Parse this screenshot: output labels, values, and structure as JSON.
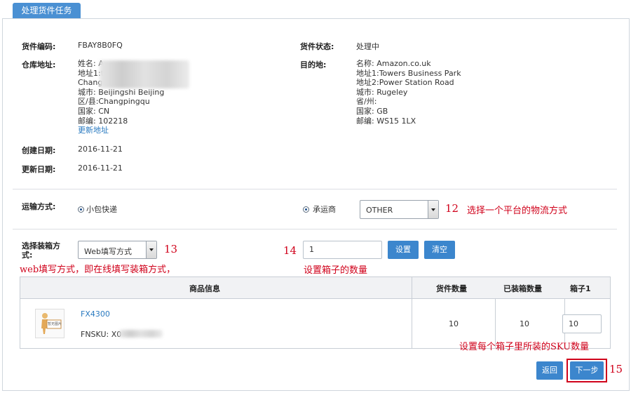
{
  "tab": {
    "title": "处理货件任务"
  },
  "shipment": {
    "code_label": "货件编码:",
    "code_value": "FBAY8B0FQ",
    "status_label": "货件状态:",
    "status_value": "处理中",
    "warehouse_label": "仓库地址:",
    "warehouse_lines": [
      "姓名: A",
      "地址1:t",
      "Chang",
      "城市: Beijingshi Beijing",
      "区/县:Changpingqu",
      "国家: CN",
      "邮编: 102218"
    ],
    "update_address_link": "更新地址",
    "destination_label": "目的地:",
    "destination_lines": [
      "名称: Amazon.co.uk",
      "地址1:Towers Business Park",
      "地址2:Power Station Road",
      "城市: Rugeley",
      "省/州:",
      "国家: GB",
      "邮编: WS15 1LX"
    ],
    "created_label": "创建日期:",
    "created_value": "2016-11-21",
    "updated_label": "更新日期:",
    "updated_value": "2016-11-21"
  },
  "shipping": {
    "label": "运输方式:",
    "option_small_parcel": "小包快递",
    "option_carrier": "承运商",
    "carrier_select_value": "OTHER"
  },
  "packing": {
    "label_line1": "选择装箱方",
    "label_line2": "式:",
    "select_value": "Web填写方式",
    "box_count_value": "1",
    "set_button": "设置",
    "clear_button": "清空"
  },
  "annotations": {
    "n12": "12",
    "t12": "选择一个平台的物流方式",
    "n13": "13",
    "t13": "web填写方式，即在线填写装箱方式，",
    "n14": "14",
    "t14": "设置箱子的数量",
    "t_sku": "设置每个箱子里所装的SKU数量",
    "n15": "15"
  },
  "table": {
    "headers": [
      "商品信息",
      "货件数量",
      "已装箱数量",
      "箱子1"
    ],
    "rows": [
      {
        "thumb_text": "暂无图片",
        "sku_link": "FX4300",
        "fnsku": "FNSKU: X0",
        "qty": "10",
        "packed": "10",
        "box1": "10"
      }
    ]
  },
  "footer": {
    "back_button": "返回",
    "next_button": "下一步"
  },
  "colors": {
    "primary": "#3c86cd",
    "annotation": "#d0021b",
    "link": "#2a7ac0"
  }
}
